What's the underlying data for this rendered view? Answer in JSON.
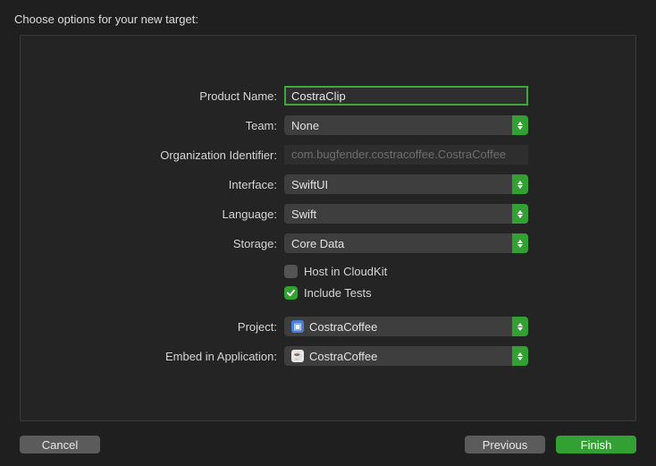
{
  "dialog": {
    "title": "Choose options for your new target:"
  },
  "labels": {
    "productName": "Product Name:",
    "team": "Team:",
    "orgId": "Organization Identifier:",
    "interface": "Interface:",
    "language": "Language:",
    "storage": "Storage:",
    "project": "Project:",
    "embed": "Embed in Application:"
  },
  "values": {
    "productName": "CostraClip",
    "team": "None",
    "orgId": "com.bugfender.costracoffee.CostraCoffee",
    "interface": "SwiftUI",
    "language": "Swift",
    "storage": "Core Data",
    "project": "CostraCoffee",
    "embed": "CostraCoffee"
  },
  "checkboxes": {
    "hostCloudKit": {
      "label": "Host in CloudKit",
      "checked": false
    },
    "includeTests": {
      "label": "Include Tests",
      "checked": true
    }
  },
  "buttons": {
    "cancel": "Cancel",
    "previous": "Previous",
    "finish": "Finish"
  }
}
